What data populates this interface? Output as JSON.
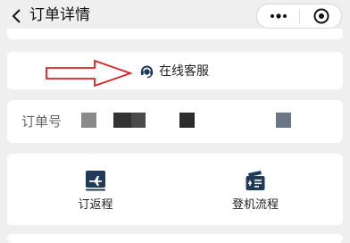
{
  "header": {
    "title": "订单详情",
    "more_icon": "more-dots-icon",
    "close_icon": "target-circle-icon"
  },
  "service": {
    "label": "在线客服",
    "icon": "headset-icon"
  },
  "order": {
    "label": "订单号"
  },
  "actions": [
    {
      "label": "订返程",
      "icon": "flight-icon"
    },
    {
      "label": "登机流程",
      "icon": "boarding-pass-icon"
    }
  ],
  "colors": {
    "accent": "#1f3b57",
    "arrow": "#d62020"
  }
}
